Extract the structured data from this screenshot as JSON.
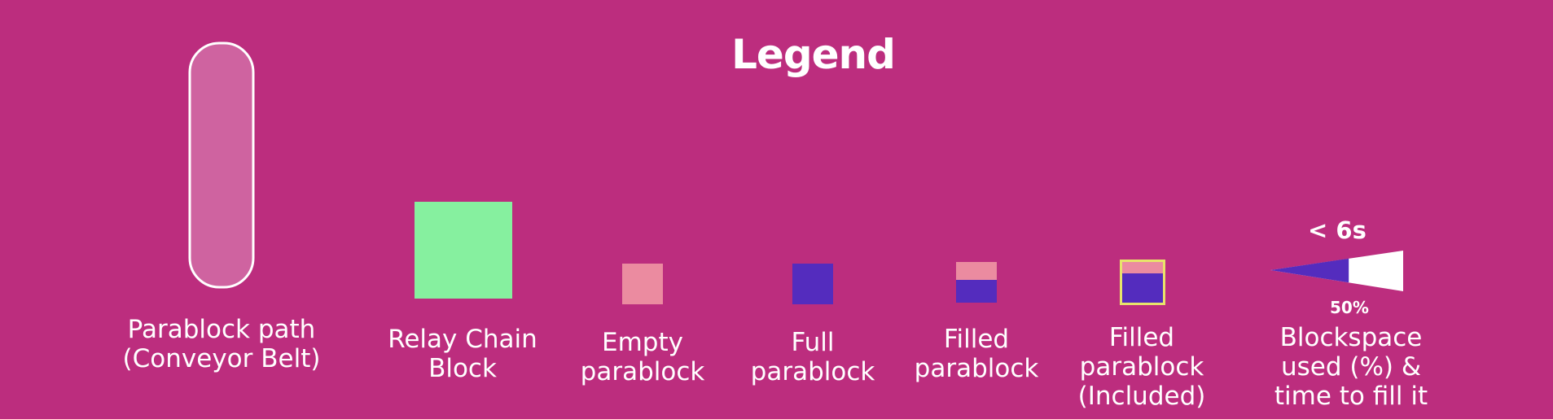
{
  "title": "Legend",
  "colors": {
    "background": "#BC2D7E",
    "conveyor_fill": "#CF63A0",
    "relay_chain_block": "#86F09F",
    "empty_parablock": "#EB8BA0",
    "full_parablock": "#542CBE",
    "included_border": "#E8E46A",
    "white": "#FFFFFF"
  },
  "items": [
    {
      "name": "conveyor-belt",
      "lines": [
        "Parablock path",
        "(Conveyor Belt)"
      ]
    },
    {
      "name": "relay-chain-block",
      "lines": [
        "Relay Chain",
        "Block"
      ]
    },
    {
      "name": "empty-parablock",
      "lines": [
        "Empty",
        "parablock"
      ]
    },
    {
      "name": "full-parablock",
      "lines": [
        "Full",
        "parablock"
      ]
    },
    {
      "name": "filled-parablock",
      "lines": [
        "Filled",
        "parablock"
      ]
    },
    {
      "name": "filled-parablock-included",
      "lines": [
        "Filled",
        "parablock",
        "(Included)"
      ]
    },
    {
      "name": "blockspace-indicator",
      "lines": [
        "Blockspace",
        "used (%) &",
        "time to fill it"
      ]
    }
  ],
  "blockspace": {
    "time_label": "< 6s",
    "percent_label": "50%",
    "fill_fraction": 0.5
  }
}
